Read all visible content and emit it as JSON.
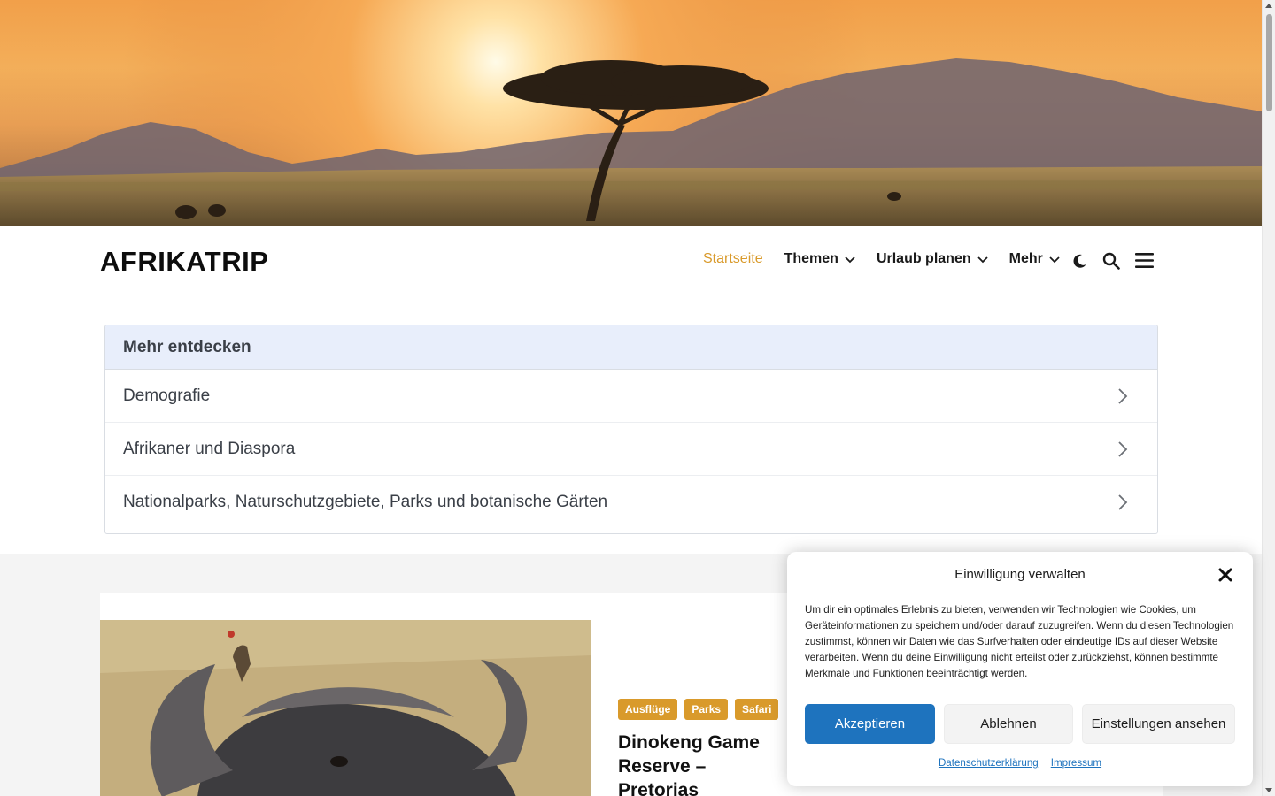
{
  "hero": {
    "image": "african-savanna-sunset-acacia-tree"
  },
  "header": {
    "logo": "AFRIKATRIP",
    "nav": [
      {
        "label": "Startseite",
        "active": true,
        "dropdown": false
      },
      {
        "label": "Themen",
        "active": false,
        "dropdown": true
      },
      {
        "label": "Urlaub planen",
        "active": false,
        "dropdown": true
      },
      {
        "label": "Mehr",
        "active": false,
        "dropdown": true
      }
    ],
    "icons": [
      "dark-mode-icon",
      "search-icon",
      "menu-icon"
    ]
  },
  "discover": {
    "title": "Mehr entdecken",
    "items": [
      "Demografie",
      "Afrikaner und Diaspora",
      "Nationalparks, Naturschutzgebiete, Parks und botanische Gärten"
    ]
  },
  "article": {
    "image": "cape-buffalo-with-oxpecker",
    "tags": [
      "Ausflüge",
      "Parks",
      "Safari"
    ],
    "title": "Dinokeng Game Reserve – Pretorias"
  },
  "consent": {
    "title": "Einwilligung verwalten",
    "text": "Um dir ein optimales Erlebnis zu bieten, verwenden wir Technologien wie Cookies, um Geräteinformationen zu speichern und/oder darauf zuzugreifen. Wenn du diesen Technologien zustimmst, können wir Daten wie das Surfverhalten oder eindeutige IDs auf dieser Website verarbeiten. Wenn du deine Einwilligung nicht erteilst oder zurückziehst, können bestimmte Merkmale und Funktionen beeinträchtigt werden.",
    "accept": "Akzeptieren",
    "decline": "Ablehnen",
    "settings": "Einstellungen ansehen",
    "links": [
      "Datenschutzerklärung",
      "Impressum"
    ]
  },
  "colors": {
    "accent": "#d99a2b",
    "primary_button": "#1e73be",
    "discover_header": "#e8eefb"
  }
}
